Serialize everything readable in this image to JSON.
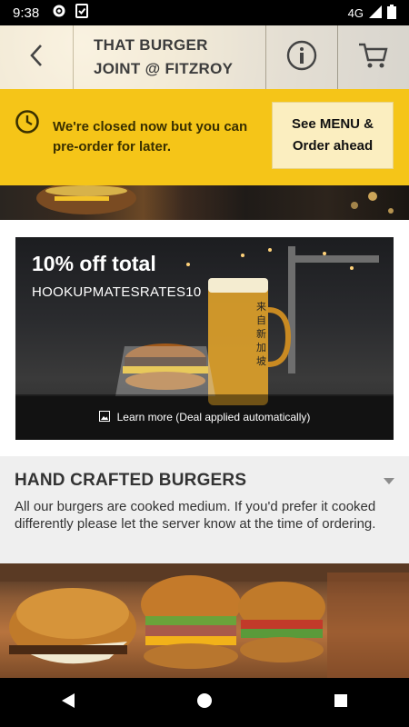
{
  "status_bar": {
    "time": "9:38",
    "network": "4G",
    "icons": [
      "gear-icon",
      "clipboard-check-icon",
      "signal-icon",
      "battery-icon"
    ]
  },
  "app_bar": {
    "title_line1": "THAT BURGER",
    "title_line2": "JOINT @ FITZROY",
    "icons": [
      "back-arrow-icon",
      "info-icon",
      "cart-icon"
    ]
  },
  "notice": {
    "message": "We're closed now but you can pre-order for later.",
    "button_label": "See MENU & Order ahead",
    "icon": "clock-icon",
    "color": "#f5c518"
  },
  "deal": {
    "title": "10% off total",
    "code": "HOOKUPMATESRATES10",
    "footer_text": "Learn more (Deal applied automatically)",
    "glass_text": "来自新加坡",
    "footer_icon": "image-icon"
  },
  "category": {
    "title": "HAND CRAFTED BURGERS",
    "description": "All our burgers are cooked medium. If you'd prefer it cooked differently please let the server know at the time of ordering.",
    "caret_icon": "chevron-down-icon"
  },
  "nav_bar": {
    "icons": [
      "back-triangle-icon",
      "home-circle-icon",
      "recents-square-icon"
    ]
  }
}
